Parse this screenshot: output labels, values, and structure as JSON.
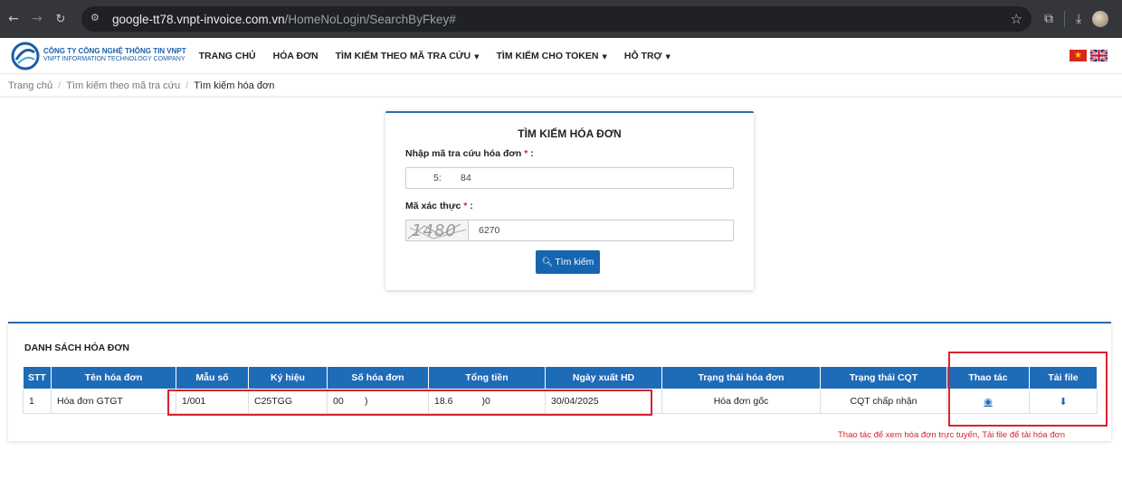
{
  "browser": {
    "url_host": "google-tt78.vnpt-invoice.com.vn",
    "url_path": "/HomeNoLogin/SearchByFkey#"
  },
  "header": {
    "logo_name": "CÔNG TY CÔNG NGHỆ THÔNG TIN VNPT",
    "logo_sub": "VNPT INFORMATION TECHNOLOGY COMPANY",
    "nav": [
      {
        "label": "TRANG CHỦ"
      },
      {
        "label": "HÓA ĐƠN"
      },
      {
        "label": "TÌM KIẾM THEO MÃ TRA CỨU",
        "dropdown": true
      },
      {
        "label": "TÌM KIẾM CHO TOKEN",
        "dropdown": true
      },
      {
        "label": "HỖ TRỢ",
        "dropdown": true
      }
    ]
  },
  "breadcrumb": {
    "items": [
      "Trang chủ",
      "Tìm kiếm theo mã tra cứu"
    ],
    "current": "Tìm kiếm hóa đơn"
  },
  "search_form": {
    "title": "TÌM KIẾM HÓA ĐƠN",
    "code_label": "Nhập mã tra cứu hóa đơn",
    "code_value_left": "5:",
    "code_value_right": "84",
    "captcha_label": "Mã xác thực",
    "captcha_image_text": "1480",
    "captcha_value": "6270",
    "required_mark": "*",
    "label_suffix": ":",
    "submit_label": "Tìm kiếm"
  },
  "invoice_list": {
    "title": "DANH SÁCH HÓA ĐƠN",
    "columns": [
      "STT",
      "Tên hóa đơn",
      "Mẫu số",
      "Ký hiệu",
      "Số hóa đơn",
      "Tổng tiền",
      "Ngày xuất HD",
      "Trạng thái hóa đơn",
      "Trạng thái CQT",
      "Thao tác",
      "Tải file"
    ],
    "rows": [
      {
        "stt": "1",
        "name": "Hóa đơn GTGT",
        "template": "1/001",
        "symbol": "C25TGG",
        "number": "00        )",
        "total": "18.6           )0",
        "date": "30/04/2025",
        "status": "Hóa đơn gốc",
        "cqt_status": "CQT chấp nhận",
        "view_icon": "eye-icon",
        "download_icon": "download-icon"
      }
    ]
  },
  "annotation": {
    "note": "Thao tác để xem hóa đơn trực tuyến, Tải file để tải hóa đơn",
    "color": "#d9232e"
  },
  "colors": {
    "primary": "#1e6bb8",
    "button": "#1565b0",
    "browser_bar": "#35363a"
  }
}
